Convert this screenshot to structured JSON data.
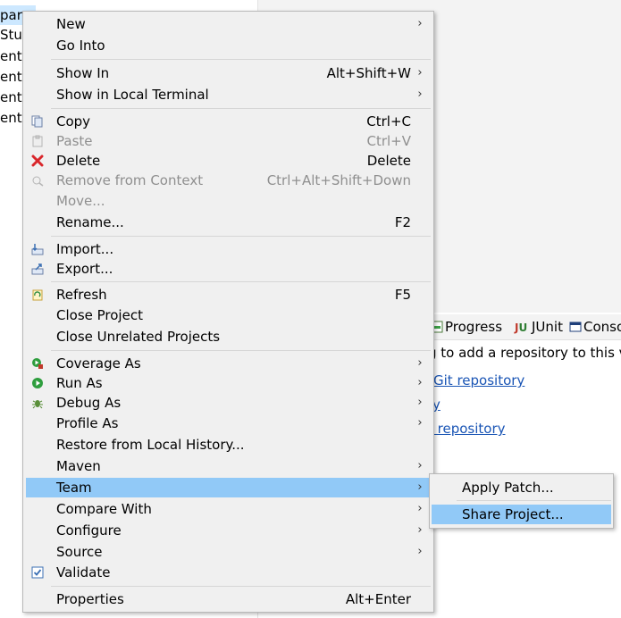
{
  "tree": {
    "rows": [
      "par",
      "Stu",
      "ent",
      "ent",
      "ent",
      "ent"
    ]
  },
  "view_tabs": {
    "progress": "Progress",
    "junit_prefix": "J",
    "junit_u": "U",
    "junit": "JUnit",
    "console": "Conso"
  },
  "panel": {
    "line1": "g to add a repository to this v",
    "link1": "Git repository",
    "link2": "y",
    "link3": "t repository"
  },
  "menu": {
    "new": "New",
    "go_into": "Go Into",
    "show_in": "Show In",
    "show_in_shortcut": "Alt+Shift+W",
    "show_in_terminal": "Show in Local Terminal",
    "copy": "Copy",
    "copy_shortcut": "Ctrl+C",
    "paste": "Paste",
    "paste_shortcut": "Ctrl+V",
    "delete": "Delete",
    "delete_shortcut": "Delete",
    "remove_context": "Remove from Context",
    "remove_context_shortcut": "Ctrl+Alt+Shift+Down",
    "move": "Move...",
    "rename": "Rename...",
    "rename_shortcut": "F2",
    "import": "Import...",
    "export": "Export...",
    "refresh": "Refresh",
    "refresh_shortcut": "F5",
    "close_project": "Close Project",
    "close_unrelated": "Close Unrelated Projects",
    "coverage_as": "Coverage As",
    "run_as": "Run As",
    "debug_as": "Debug As",
    "profile_as": "Profile As",
    "restore_history": "Restore from Local History...",
    "maven": "Maven",
    "team": "Team",
    "compare_with": "Compare With",
    "configure": "Configure",
    "source": "Source",
    "validate": "Validate",
    "properties": "Properties",
    "properties_shortcut": "Alt+Enter",
    "arrow": "›"
  },
  "team_submenu": {
    "apply_patch": "Apply Patch...",
    "share_project": "Share Project..."
  },
  "colors": {
    "highlight": "#91c9f7",
    "menu_bg": "#f0f0f0",
    "link": "#1a55b5",
    "disabled": "#8f8f8f"
  }
}
